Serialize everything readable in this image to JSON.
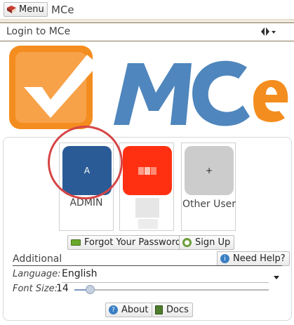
{
  "topbar": {
    "menu_label": "Menu",
    "app_title": "MCe"
  },
  "login_bar": {
    "title": "Login to MCe"
  },
  "users": [
    {
      "initial": "A",
      "name": "ADMIN",
      "color": "#2a5b96"
    },
    {
      "initial": "",
      "name": "",
      "color": "#ff3012"
    },
    {
      "initial": "+",
      "name": "Other User",
      "color": "#cccccc"
    }
  ],
  "links": {
    "forgot_password": "Forgot Your Password",
    "sign_up": "Sign Up",
    "need_help": "Need Help?",
    "about": "About",
    "docs": "Docs"
  },
  "additional": {
    "heading": "Additional",
    "language_label": "Language:",
    "language_value": "English",
    "font_size_label": "Font Size:",
    "font_size_value": "14",
    "font_size_level": 0.06
  },
  "colors": {
    "brand_orange": "#f48d1f",
    "brand_blue": "#4f86bd",
    "highlight_ring": "#d64545"
  }
}
